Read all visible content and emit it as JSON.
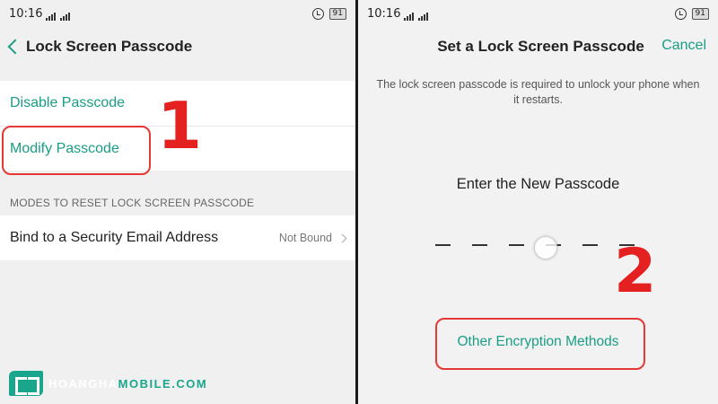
{
  "left": {
    "status": {
      "time": "10:16",
      "battery": "91"
    },
    "title": "Lock Screen Passcode",
    "items": [
      "Disable Passcode",
      "Modify Passcode"
    ],
    "section_header": "MODES TO RESET LOCK SCREEN PASSCODE",
    "email_row": {
      "label": "Bind to a Security Email Address",
      "value": "Not Bound"
    },
    "annotation": "1"
  },
  "right": {
    "status": {
      "time": "10:16",
      "battery": "91"
    },
    "title": "Set a Lock Screen Passcode",
    "cancel": "Cancel",
    "info": "The lock screen passcode is required to unlock your phone when it restarts.",
    "prompt": "Enter the New Passcode",
    "other": "Other Encryption Methods",
    "annotation": "2"
  },
  "logo": {
    "part1": "HOANGHA",
    "part2": "MOBILE.COM"
  },
  "colors": {
    "accent": "#1a9d85",
    "annotation": "#e53935",
    "logo": "#1aa68c"
  }
}
